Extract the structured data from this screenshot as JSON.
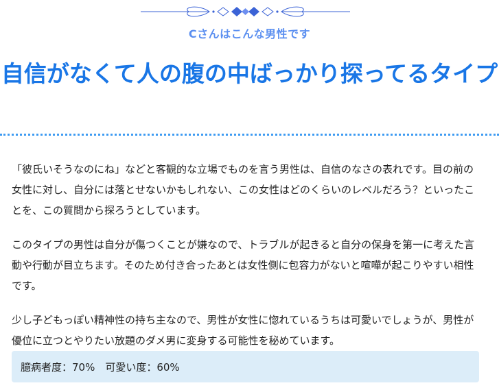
{
  "header": {
    "subtitle": "Cさんはこんな男性です",
    "title": "自信がなくて人の腹の中ばっかり探ってるタイプ"
  },
  "ornament": {
    "icon": "decorative-divider-icon",
    "color": "#3b63d6"
  },
  "colors": {
    "subtitle": "#5b8ff0",
    "title": "#1976e6",
    "divider": "#3e9bf2",
    "rating_background": "#dcedf9"
  },
  "paragraphs": [
    "「彼氏いそうなのにね」などと客観的な立場でものを言う男性は、自信のなさの表れです。目の前の女性に対し、自分には落とせないかもしれない、この女性はどのくらいのレベルだろう？といったことを、この質問から探ろうとしています。",
    "このタイプの男性は自分が傷つくことが嫌なので、トラブルが起きると自分の保身を第一に考えた言動や行動が目立ちます。そのため付き合ったあとは女性側に包容力がないと喧嘩が起こりやすい相性です。",
    "少し子どもっぽい精神性の持ち主なので、男性が女性に惚れているうちは可愛いでしょうが、男性が優位に立つとやりたい放題のダメ男に変身する可能性を秘めています。"
  ],
  "rating": {
    "text": "臆病者度：70%　可愛い度：60%"
  }
}
